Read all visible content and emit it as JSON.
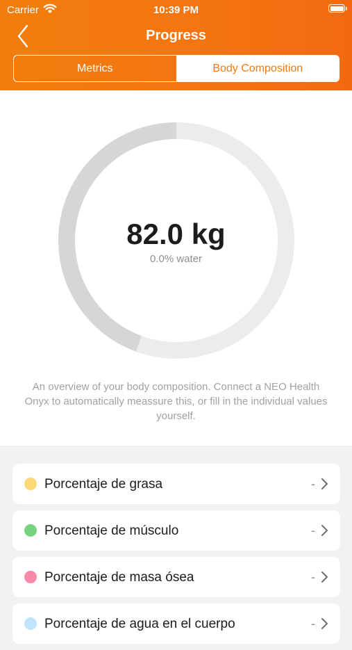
{
  "status_bar": {
    "carrier": "Carrier",
    "time": "10:39 PM"
  },
  "nav": {
    "title": "Progress"
  },
  "tabs": [
    {
      "label": "Metrics",
      "selected": false
    },
    {
      "label": "Body Composition",
      "selected": true
    }
  ],
  "summary": {
    "weight": "82.0 kg",
    "water": "0.0% water",
    "description": "An overview of your body composition. Connect a NEO Health Onyx to automatically meassure this, or fill in the individual values yourself."
  },
  "metrics": [
    {
      "label": "Porcentaje de grasa",
      "value": "-",
      "color": "#fbd978"
    },
    {
      "label": "Porcentaje de músculo",
      "value": "-",
      "color": "#76d27c"
    },
    {
      "label": "Porcentaje de masa ósea",
      "value": "-",
      "color": "#f889a9"
    },
    {
      "label": "Porcentaje de agua en el cuerpo",
      "value": "-",
      "color": "#bfe4fb"
    }
  ],
  "colors": {
    "accent": "#f27a10",
    "ring_dark": "#d5d6d8",
    "ring_light": "#ececed"
  }
}
